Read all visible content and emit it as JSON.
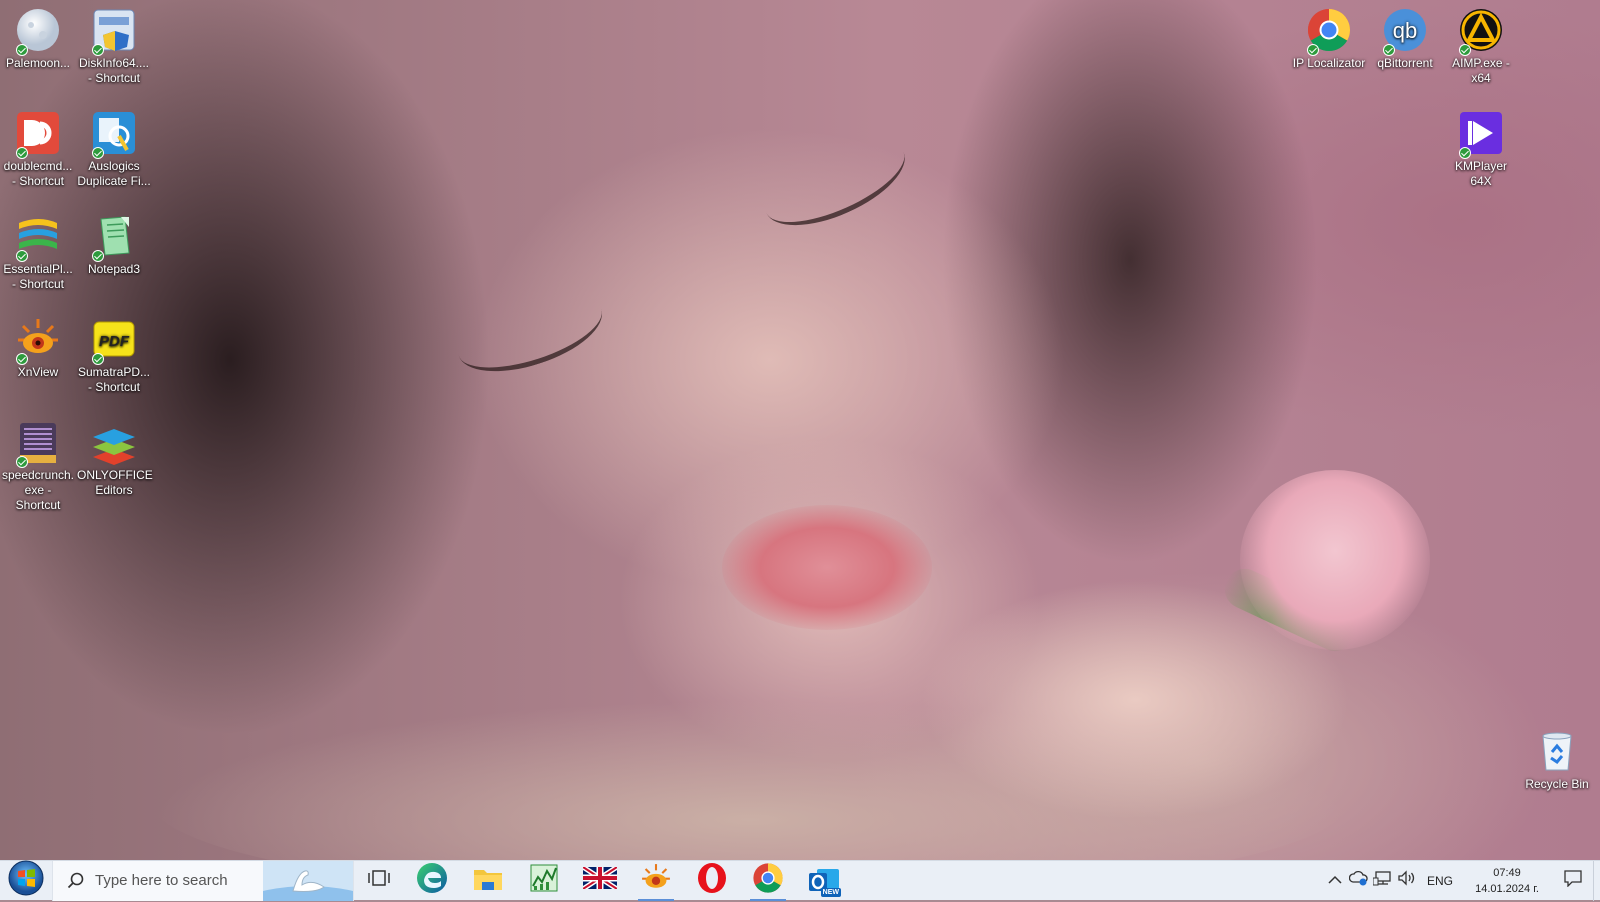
{
  "desktop": {
    "icons_left": [
      {
        "label": "Palemoon...",
        "icon": "palemoon-icon"
      },
      {
        "label": "DiskInfo64....\n- Shortcut",
        "icon": "diskinfo-icon"
      },
      {
        "label": "doublecmd...\n- Shortcut",
        "icon": "doublecmd-icon"
      },
      {
        "label": "Auslogics\nDuplicate Fi...",
        "icon": "auslogics-icon"
      },
      {
        "label": "EssentialPl...\n- Shortcut",
        "icon": "essentialpim-icon"
      },
      {
        "label": "Notepad3",
        "icon": "notepad3-icon"
      },
      {
        "label": "XnView",
        "icon": "xnview-icon"
      },
      {
        "label": "SumatraPD...\n- Shortcut",
        "icon": "sumatrapdf-icon"
      },
      {
        "label": "speedcrunch.\nexe -\nShortcut",
        "icon": "speedcrunch-icon"
      },
      {
        "label": "ONLYOFFICE\nEditors",
        "icon": "onlyoffice-icon"
      }
    ],
    "icons_right": [
      {
        "label": "IP Localizator",
        "icon": "chrome-icon"
      },
      {
        "label": "qBittorrent",
        "icon": "qbittorrent-icon",
        "text": "qb"
      },
      {
        "label": "AIMP.exe -\nx64",
        "icon": "aimp-icon"
      },
      {
        "label": "KMPlayer 64X",
        "icon": "kmplayer-icon"
      }
    ],
    "recycle_bin": {
      "label": "Recycle Bin",
      "icon": "recycle-bin-icon"
    }
  },
  "taskbar": {
    "start_icon": "windows-start-icon",
    "search": {
      "placeholder": "Type here to search",
      "icon": "search-icon"
    },
    "task_view_icon": "task-view-icon",
    "apps": [
      {
        "name": "edge-icon",
        "active": false
      },
      {
        "name": "file-explorer-icon",
        "active": false
      },
      {
        "name": "task-manager-chart-icon",
        "active": false
      },
      {
        "name": "uk-flag-icon",
        "active": false
      },
      {
        "name": "xnview-taskbar-icon",
        "active": true
      },
      {
        "name": "opera-icon",
        "active": false
      },
      {
        "name": "chrome-taskbar-icon",
        "active": true
      },
      {
        "name": "outlook-new-icon",
        "active": false,
        "badge": "NEW"
      }
    ],
    "tray": {
      "chevron_icon": "show-hidden-icons-chevron",
      "onedrive_icon": "onedrive-sync-icon",
      "network_icon": "network-icon",
      "volume_icon": "volume-icon",
      "language": "ENG",
      "time": "07:49",
      "date": "14.01.2024 г.",
      "notification_icon": "action-center-icon"
    }
  },
  "colors": {
    "taskbar_bg": "#eaeff6",
    "accent": "#5b8fd8",
    "check_green": "#2e9b3d"
  }
}
